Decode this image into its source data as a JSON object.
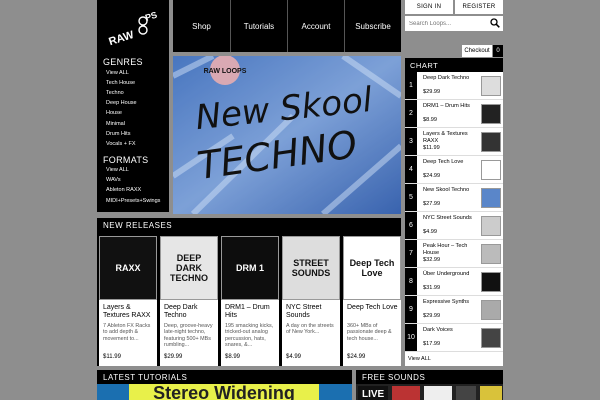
{
  "logo_text": "RAW LOOPS",
  "sidebar": {
    "genres_heading": "GENRES",
    "genres": [
      "View ALL",
      "Tech House",
      "Techno",
      "Deep House",
      "House",
      "Minimal",
      "Drum Hits",
      "Vocals + FX"
    ],
    "formats_heading": "FORMATS",
    "formats": [
      "View ALL",
      "WAVs",
      "Ableton RAXX",
      "MIDI+Presets+Swings"
    ]
  },
  "nav": [
    "Shop",
    "Tutorials",
    "Account",
    "Subscribe"
  ],
  "auth": {
    "signin": "SIGN IN",
    "register": "REGISTER"
  },
  "search": {
    "placeholder": "Search Loops..."
  },
  "cart": {
    "checkout": "Checkout",
    "count": "0"
  },
  "banner": {
    "brand": "RAW LOOPS",
    "line1": "New Skool",
    "line2": "TECHNO"
  },
  "chart": {
    "heading": "CHART",
    "items": [
      {
        "rank": "1",
        "title": "Deep Dark Techno",
        "price": "$29.99"
      },
      {
        "rank": "2",
        "title": "DRM1 – Drum Hits",
        "price": "$8.99"
      },
      {
        "rank": "3",
        "title": "Layers & Textures RAXX",
        "price": "$11.99"
      },
      {
        "rank": "4",
        "title": "Deep Tech Love",
        "price": "$24.99"
      },
      {
        "rank": "5",
        "title": "New Skool Techno",
        "price": "$27.99"
      },
      {
        "rank": "6",
        "title": "NYC Street Sounds",
        "price": "$4.99"
      },
      {
        "rank": "7",
        "title": "Peak Hour – Tech House",
        "price": "$32.99"
      },
      {
        "rank": "8",
        "title": "Über Underground",
        "price": "$31.99"
      },
      {
        "rank": "9",
        "title": "Expressive Synths",
        "price": "$29.99"
      },
      {
        "rank": "10",
        "title": "Dark Voices",
        "price": "$17.99"
      }
    ],
    "view_all": "View ALL"
  },
  "new_releases": {
    "heading": "NEW RELEASES",
    "items": [
      {
        "title": "Layers & Textures RAXX",
        "desc": "7 Ableton FX Racks to add depth & movement to...",
        "price": "$11.99",
        "cover": "RAXX"
      },
      {
        "title": "Deep Dark Techno",
        "desc": "Deep, groove-heavy late-night techno, featuring 500+ MBs rumbling...",
        "price": "$29.99",
        "cover": "DEEP DARK TECHNO"
      },
      {
        "title": "DRM1 – Drum Hits",
        "desc": "195 smacking kicks, tricked-out analog percussion, hats, snares, &...",
        "price": "$8.99",
        "cover": "DRM 1"
      },
      {
        "title": "NYC Street Sounds",
        "desc": "A day on the streets of New York...",
        "price": "$4.99",
        "cover": "STREET SOUNDS"
      },
      {
        "title": "Deep Tech Love",
        "desc": "360+ MBs of passionate deep & tech house...",
        "price": "$24.99",
        "cover": "Deep Tech Love"
      }
    ]
  },
  "tutorials": {
    "heading": "LATEST TUTORIALS",
    "preview_text": "Stereo Widening"
  },
  "free_sounds": {
    "heading": "FREE SOUNDS",
    "preview_text": "LIVE"
  }
}
